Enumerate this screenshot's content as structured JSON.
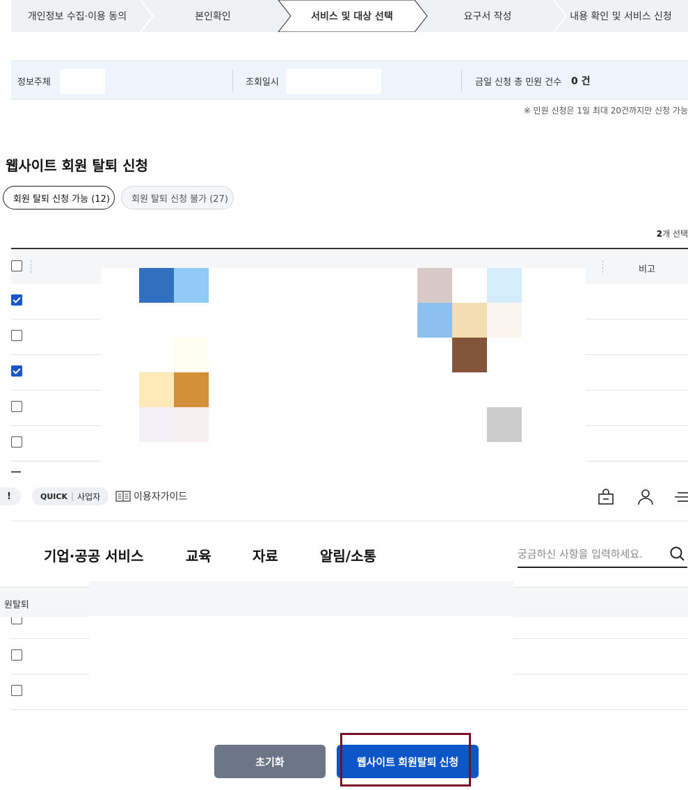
{
  "steps": [
    {
      "label": "개인정보 수집·이용 동의"
    },
    {
      "label": "본인확인"
    },
    {
      "label": "서비스 및 대상 선택",
      "active": true
    },
    {
      "label": "요구서 작성"
    },
    {
      "label": "내용 확인 및 서비스 신청"
    }
  ],
  "info": {
    "subject_label": "정보주체",
    "date_label": "조회일시",
    "count_label": "금일 신청 총 민원 건수",
    "count_value": "0 건"
  },
  "notice": "※ 민원 신청은 1일 최대 20건까지만 신청 가능",
  "section": {
    "title": "웹사이트 회원 탈퇴 신청",
    "filters": [
      {
        "label": "회원 탈퇴 신청 가능 (12)",
        "selected": true
      },
      {
        "label": "회원 탈퇴 신청 불가 (27)",
        "selected": false
      }
    ],
    "selected_count": "2",
    "selected_suffix": "개 선택"
  },
  "table": {
    "note_header": "비고",
    "rows_checked": [
      true,
      false,
      true,
      false,
      false
    ]
  },
  "header": {
    "bang": "!",
    "quick_label": "QUICK",
    "quick_item": "사업자",
    "guide_label": "이용자가이드",
    "nav": [
      "기업·공공 서비스",
      "교육",
      "자료",
      "알림/소통"
    ],
    "search_placeholder": "궁금하신 사항을 입력하세요."
  },
  "lower": {
    "header_text": "원탈퇴"
  },
  "buttons": {
    "reset": "초기화",
    "apply": "웹사이트 회원탈퇴 신청"
  },
  "colors": {
    "primary": "#0d56c8",
    "reset_gray": "#6c7687",
    "highlight": "#7a0e24",
    "info_bg": "#eef4fb"
  },
  "mosaic_tiles": [
    {
      "c": "#316fc0"
    },
    {
      "c": "#90cbf7"
    },
    {
      "c": "#d8c8c8"
    },
    {
      "c": "#d4ecfb"
    },
    {
      "c": "#8cc0ee"
    },
    {
      "c": "#f4ddb0"
    },
    {
      "c": "#fdf6f0"
    },
    {
      "c": "#fffef0"
    },
    {
      "c": "#83563c"
    },
    {
      "c": "#fdeab8"
    },
    {
      "c": "#d49038"
    },
    {
      "c": "#f3f1f7"
    },
    {
      "c": "#f8f0f0"
    },
    {
      "c": "#cbcbcb"
    }
  ]
}
